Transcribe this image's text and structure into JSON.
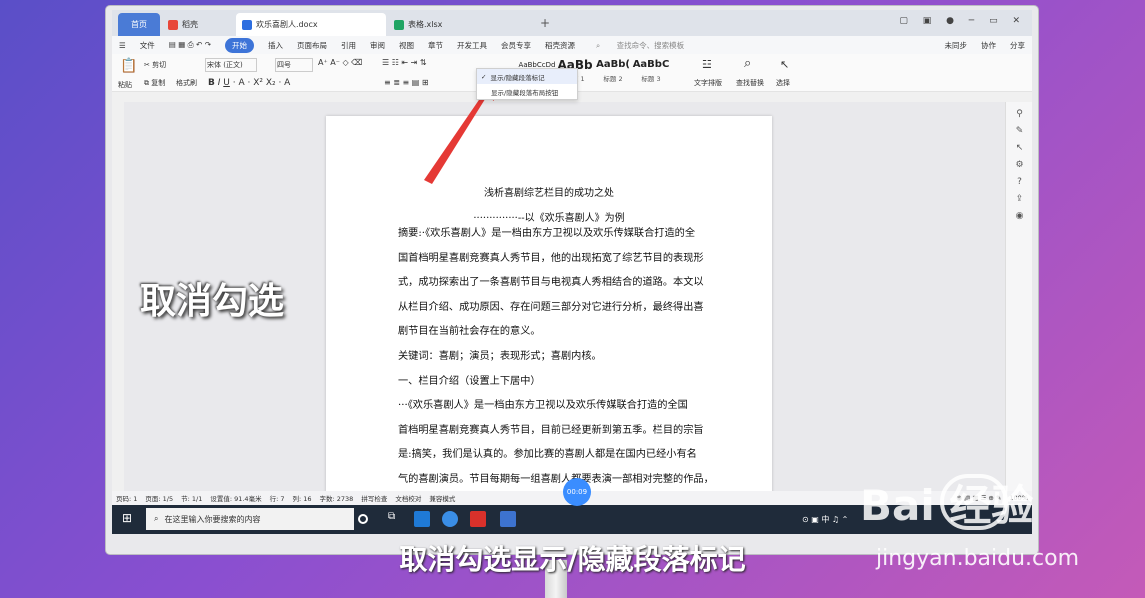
{
  "tabs": {
    "home": "首页",
    "t1": "稻壳",
    "t2": "欢乐喜剧人.docx",
    "t3": "表格.xlsx"
  },
  "menu": [
    "文件",
    "开始",
    "插入",
    "页面布局",
    "引用",
    "审阅",
    "视图",
    "章节",
    "开发工具",
    "会员专享",
    "稻壳资源",
    "查找命令、搜索模板",
    "未同步",
    "协作",
    "分享"
  ],
  "ribbon": {
    "cut": "剪切",
    "copy": "复制",
    "paste": "粘贴",
    "format": "格式刷",
    "font": "宋体 (正文)",
    "size": "四号",
    "textlayout": "文字排版",
    "findreplace": "查找替换",
    "select": "选择"
  },
  "styles": [
    {
      "sample": "AaBbCcDd",
      "name": "正文"
    },
    {
      "sample": "AaBb",
      "name": "标题 1"
    },
    {
      "sample": "AaBb(",
      "name": "标题 2"
    },
    {
      "sample": "AaBbC",
      "name": "标题 3"
    }
  ],
  "dropdown": {
    "item1": "显示/隐藏段落标记",
    "item2": "显示/隐藏段落布局按钮"
  },
  "doc": {
    "title": "浅析喜剧综艺栏目的成功之处",
    "subtitle": "··············--以《欢乐喜剧人》为例",
    "lines": [
      "摘要:·《欢乐喜剧人》是一档由东方卫视以及欢乐传媒联合打造的全",
      "国首档明星喜剧竞赛真人秀节目，他的出现拓宽了综艺节目的表现形",
      "式，成功探索出了一条喜剧节目与电视真人秀相结合的道路。本文以",
      "从栏目介绍、成功原因、存在问题三部分对它进行分析，最终得出喜",
      "剧节目在当前社会存在的意义。",
      "关键词：喜剧；演员；表现形式；喜剧内核。",
      "一、栏目介绍（设置上下居中）",
      "···《欢乐喜剧人》是一档由东方卫视以及欢乐传媒联合打造的全国",
      "首档明星喜剧竞赛真人秀节目，目前已经更新到第五季。栏目的宗旨",
      "是:搞笑，我们是认真的。参加比赛的喜剧人都是在国内已经小有名",
      "气的喜剧演员。节目每期每一组喜剧人都要表演一部相对完整的作品，"
    ]
  },
  "status": [
    "页码: 1",
    "页面: 1/5",
    "节: 1/1",
    "设置值: 91.4毫米",
    "行: 7",
    "列: 16",
    "字数: 2738",
    "拼写检查",
    "文档校对",
    "兼容模式",
    "100%"
  ],
  "taskbar": {
    "search": "在这里输入你要搜索的内容"
  },
  "overlay": "取消勾选",
  "caption": "取消勾选显示/隐藏段落标记",
  "timer": "00:09",
  "watermark": {
    "brand": "Bai 经验",
    "url": "jingyan.baidu.com"
  }
}
